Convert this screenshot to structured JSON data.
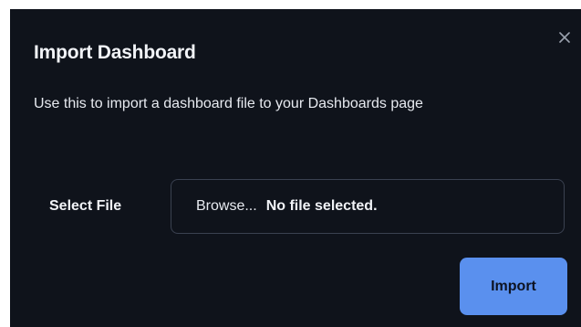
{
  "dialog": {
    "title": "Import Dashboard",
    "description": "Use this to import a dashboard file to your Dashboards page",
    "close_icon": "close-icon",
    "field_label": "Select File",
    "file_input": {
      "browse_label": "Browse...",
      "status": "No file selected."
    },
    "import_label": "Import"
  },
  "colors": {
    "background": "#0f131b",
    "primary_button": "#5a90ee",
    "input_border": "#3a4150",
    "text": "#eef1f6"
  }
}
